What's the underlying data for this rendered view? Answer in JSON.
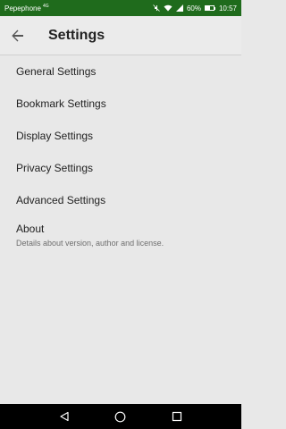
{
  "status_bar": {
    "carrier": "Pepephone",
    "network": "4G",
    "battery_text": "60%",
    "battery_level": 0.6,
    "time": "10:57",
    "icons": [
      "mute-icon",
      "wifi-icon",
      "signal-icon",
      "battery-icon"
    ],
    "background": "#1f6b1c"
  },
  "app_bar": {
    "title": "Settings",
    "back_icon": "arrow-back-icon"
  },
  "settings": {
    "items": [
      {
        "label": "General Settings"
      },
      {
        "label": "Bookmark Settings"
      },
      {
        "label": "Display Settings"
      },
      {
        "label": "Privacy Settings"
      },
      {
        "label": "Advanced Settings"
      }
    ],
    "about": {
      "label": "About",
      "summary": "Details about version, author and license."
    }
  },
  "nav_bar": {
    "buttons": [
      "back-triangle-icon",
      "home-circle-icon",
      "recents-square-icon"
    ]
  }
}
